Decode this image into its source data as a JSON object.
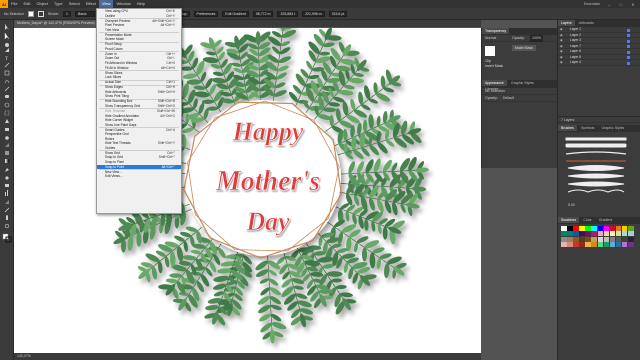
{
  "menubar": {
    "logo": "Ai",
    "items": [
      "File",
      "Edit",
      "Object",
      "Type",
      "Select",
      "Effect",
      "View",
      "Window",
      "Help"
    ],
    "active_index": 6,
    "workspace": "Graphic Tools",
    "workspace_label": "Essentials"
  },
  "controlbar": {
    "no_selection": "No Selection",
    "stroke_label": "Stroke:",
    "stroke_value": "1",
    "basic_label": "Basic",
    "opacity_label": "Opacity:",
    "opacity_value": "100%",
    "style_label": "Style:",
    "doc_setup": "Document Setup",
    "preferences": "Preferences",
    "edit_gradient": "Edit Gradient",
    "x_value": "98,772 m",
    "y_value": "225,883 t",
    "w_value": "221,996 m",
    "h_value": "315,6 pt"
  },
  "document": {
    "tab_title": "Mothers_Day.ai* @ 142,47% (RGB/GPU Preview)",
    "status_zoom": "142,47%"
  },
  "view_menu": {
    "items": [
      {
        "label": "View using CPU",
        "shortcut": "Ctrl+E"
      },
      {
        "label": "Outline",
        "shortcut": "Ctrl+Y"
      },
      {
        "sep": true
      },
      {
        "label": "Overprint Preview",
        "shortcut": "Alt+Shift+Ctrl+Y"
      },
      {
        "label": "Pixel Preview",
        "shortcut": "Alt+Ctrl+Y"
      },
      {
        "label": "Trim View",
        "shortcut": ""
      },
      {
        "sep": true
      },
      {
        "label": "Presentation Mode",
        "shortcut": ""
      },
      {
        "label": "Screen Mode",
        "shortcut": ""
      },
      {
        "sep": true
      },
      {
        "label": "Proof Setup",
        "shortcut": ""
      },
      {
        "label": "Proof Colors",
        "shortcut": ""
      },
      {
        "sep": true
      },
      {
        "label": "Zoom In",
        "shortcut": "Ctrl++"
      },
      {
        "label": "Zoom Out",
        "shortcut": "Ctrl+-"
      },
      {
        "label": "Fit Artboard in Window",
        "shortcut": "Ctrl+0"
      },
      {
        "label": "Fit All in Window",
        "shortcut": "Alt+Ctrl+0"
      },
      {
        "sep": true
      },
      {
        "label": "Show Slices",
        "shortcut": ""
      },
      {
        "label": "Lock Slices",
        "shortcut": ""
      },
      {
        "sep": true
      },
      {
        "label": "Actual Size",
        "shortcut": "Ctrl+1"
      },
      {
        "sep": true
      },
      {
        "label": "Show Edges",
        "shortcut": "Ctrl+H"
      },
      {
        "label": "Hide Artboards",
        "shortcut": "Shift+Ctrl+H"
      },
      {
        "label": "Show Print Tiling",
        "shortcut": ""
      },
      {
        "sep": true
      },
      {
        "label": "Hide Bounding Box",
        "shortcut": "Shift+Ctrl+B"
      },
      {
        "label": "Show Transparency Grid",
        "shortcut": "Shift+Ctrl+D"
      },
      {
        "sep": true
      },
      {
        "label": "Hide Template",
        "shortcut": "Shift+Ctrl+W",
        "dim": true
      },
      {
        "label": "Hide Gradient Annotator",
        "shortcut": "Alt+Ctrl+G"
      },
      {
        "label": "Hide Corner Widget",
        "shortcut": ""
      },
      {
        "label": "Show Live Paint Gaps",
        "shortcut": ""
      },
      {
        "sep": true
      },
      {
        "label": "Smart Guides",
        "shortcut": "Ctrl+U"
      },
      {
        "label": "Perspective Grid",
        "shortcut": ""
      },
      {
        "label": "Rulers",
        "shortcut": ""
      },
      {
        "label": "Hide Text Threads",
        "shortcut": "Shift+Ctrl+Y"
      },
      {
        "label": "Guides",
        "shortcut": ""
      },
      {
        "sep": true
      },
      {
        "label": "Show Grid",
        "shortcut": "Ctrl+\""
      },
      {
        "label": "Snap to Grid",
        "shortcut": "Shift+Ctrl+\""
      },
      {
        "label": "Snap to Pixel",
        "shortcut": ""
      },
      {
        "label": "Snap to Point",
        "shortcut": "Alt+Ctrl+\"",
        "highlight": true
      },
      {
        "sep": true
      },
      {
        "label": "New View...",
        "shortcut": ""
      },
      {
        "label": "Edit Views...",
        "shortcut": ""
      }
    ]
  },
  "artwork": {
    "line1": "Happy",
    "line2": "Mother's",
    "line3": "Day",
    "text_color": "#e23a3a",
    "leaf_color": "#4f8a55",
    "frame_color": "#c9895a"
  },
  "transparency_panel": {
    "title": "Transparency",
    "mode": "Normal",
    "opacity_label": "Opacity:",
    "opacity_value": "100%",
    "make_mask": "Make Mask",
    "clip": "Clip",
    "invert_mask": "Invert Mask"
  },
  "appearance_panel": {
    "tabs": [
      "Appearance",
      "Graphic Styles",
      "Libraries"
    ],
    "no_selection": "No Selection",
    "opacity_label": "Opacity:",
    "opacity_value": "Default"
  },
  "layers_panel": {
    "tabs": [
      "Layers",
      "Artboards"
    ],
    "layers": [
      "Layer 1",
      "Layer 2",
      "Layer 3",
      "Layer 7",
      "Layer 6",
      "Layer 5",
      "Layer 4"
    ],
    "footer": "7 Layers"
  },
  "brushes_panel": {
    "tabs": [
      "Brushes",
      "Symbols",
      "Graphic Styles"
    ],
    "size_label": "5.00"
  },
  "swatches_panel": {
    "tabs": [
      "Swatches",
      "Color",
      "Gradient"
    ],
    "colors": [
      "#ffffff",
      "#000000",
      "#ff0000",
      "#ffff00",
      "#00ff00",
      "#00ffff",
      "#0000ff",
      "#ff00ff",
      "#c8102e",
      "#e87722",
      "#f5d000",
      "#62a70f",
      "#00875a",
      "#007a87",
      "#005eb8",
      "#3c1053",
      "#7a0b6e",
      "#b8195d",
      "#f1a7c0",
      "#fbd4a5",
      "#fff3b0",
      "#cfe8a8",
      "#a6d9d0",
      "#a8c8e8",
      "#8c8c8c",
      "#a67c52",
      "#8b5a2b",
      "#603813",
      "#754c24",
      "#c69c6d",
      "#d9d9d9",
      "#bfbfbf",
      "#808080",
      "#595959",
      "#404040",
      "#262626",
      "#e6b8a2",
      "#d98880",
      "#c0392b",
      "#922b21",
      "#f5b041",
      "#d68910",
      "#58d68d",
      "#229954",
      "#5dade2",
      "#2471a3",
      "#af7ac5",
      "#6c3483"
    ]
  }
}
